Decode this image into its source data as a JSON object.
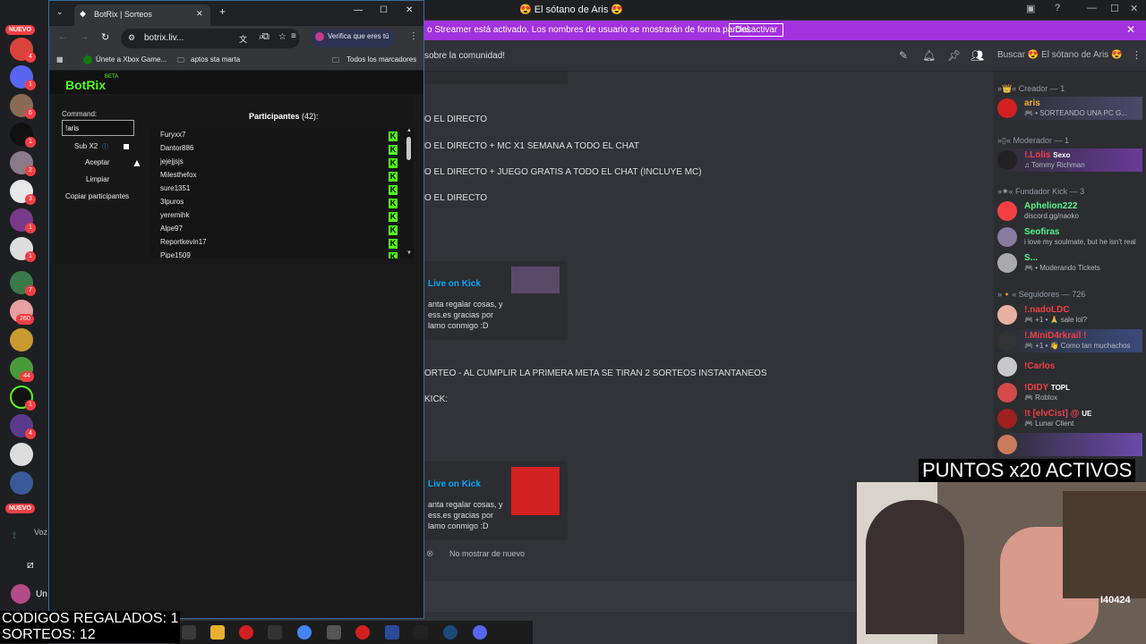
{
  "discord": {
    "window_title": "El sótano de Aris",
    "banner": {
      "text": "o Streamer está activado. Los nombres de usuario se mostrarán de forma parcial.",
      "button": "Desactivar"
    },
    "channel_header": "sobre la comunidad!",
    "search_placeholder": "Buscar 😍 El sótano de Aris 😍",
    "rail": {
      "nuevo_top": "NUEVO",
      "nuevo_bottom": "NUEVO",
      "badges": [
        "4",
        "1",
        "6",
        "1",
        "2",
        "3",
        "1",
        "1",
        "7",
        "260",
        "44",
        "1",
        "4"
      ],
      "bottom_labels": [
        "Voz",
        "Un"
      ]
    },
    "chat": {
      "lines": [
        "O EL DIRECTO",
        "O EL DIRECTO + MC X1 SEMANA A TODO EL CHAT",
        "O EL DIRECTO + JUEGO GRATIS A TODO EL CHAT (INCLUYE MC)",
        "O EL DIRECTO",
        "ORTEO - AL CUMPLIR LA PRIMERA META SE TIRAN 2 SORTEOS INSTANTANEOS",
        "KICK:"
      ],
      "embed1": {
        "title": "Live on Kick",
        "desc": [
          "anta regalar cosas, y",
          "ess.es gracias por",
          "lamo conmigo :D"
        ]
      },
      "embed2": {
        "title": "Live on Kick",
        "desc": [
          "anta regalar cosas, y",
          "ess.es gracias por",
          "lamo conmigo :D"
        ]
      },
      "top_fragment": "lamo conmigo :D",
      "no_mostrar": "No mostrar de nuevo"
    },
    "members": {
      "cat_creador": "»👑« Creador — 1",
      "cat_moderador": "»▯« Moderador — 1",
      "cat_fundador": "»✷« Fundador Kick — 3",
      "cat_seguidores": "»🔸« Seguidores — 726",
      "list": [
        {
          "name": "aris",
          "sub": "🎮 • SORTEANDO UNA PC G...",
          "color": "#f0b232"
        },
        {
          "name": "!.Lolis",
          "sub": "♫ Tommy Richman",
          "color": "#f23f43",
          "tag": "Sexo"
        },
        {
          "name": "Aphelion222",
          "sub": "discord.gg/naoko",
          "color": "#57f287"
        },
        {
          "name": "Seofiras",
          "sub": "i love my soulmate, but he isn't real",
          "color": "#57f287"
        },
        {
          "name": "S...",
          "sub": "🎮 • Moderando Tickets",
          "color": "#57f287"
        },
        {
          "name": "!.nadoLDC",
          "sub": "🎮 +1 • 🙏 sale lol?",
          "color": "#f23f43"
        },
        {
          "name": "!.MiniD4rkrail !",
          "sub": "🎮 +1 • 👋 Como tan muchachos",
          "color": "#f23f43"
        },
        {
          "name": "!Carlos",
          "sub": "",
          "color": "#f23f43"
        },
        {
          "name": "!DIDY",
          "sub": "🎮 Roblox",
          "color": "#f23f43",
          "tag": "TOPL"
        },
        {
          "name": "!t [elvCist] @",
          "sub": "🎮 Lunar Client",
          "color": "#f23f43",
          "tag": "UE"
        }
      ]
    }
  },
  "chrome": {
    "tab_title": "BotRix | Sorteos",
    "url": "botrix.liv...",
    "verifica": "Verifica que eres tú",
    "bookmarks": [
      "Únete a Xbox Game...",
      "aptos sta marta",
      "Todos los marcadores"
    ]
  },
  "botrix": {
    "logo": "BotRix",
    "beta": "BETA",
    "command_label": "Command:",
    "command_value": "!aris",
    "sub_x2": "Sub X2",
    "aceptar": "Aceptar",
    "limpiar": "Limpiar",
    "copiar": "Copiar participantes",
    "participantes_label": "Participantes",
    "participantes_count": "(42):",
    "participants": [
      "Furyxx7",
      "Dantor886",
      "jejejjsjs",
      "Milesthefox",
      "sure1351",
      "3lpuros",
      "yeremihk",
      "Alpe97",
      "Reportkevin17",
      "Pipe1509"
    ]
  },
  "overlays": {
    "puntos": "PUNTOS x20 ACTIVOS",
    "codigos": "CODIGOS REGALADOS: 1",
    "sorteos": "SORTEOS: 12",
    "webcam_tag": "I40424"
  }
}
